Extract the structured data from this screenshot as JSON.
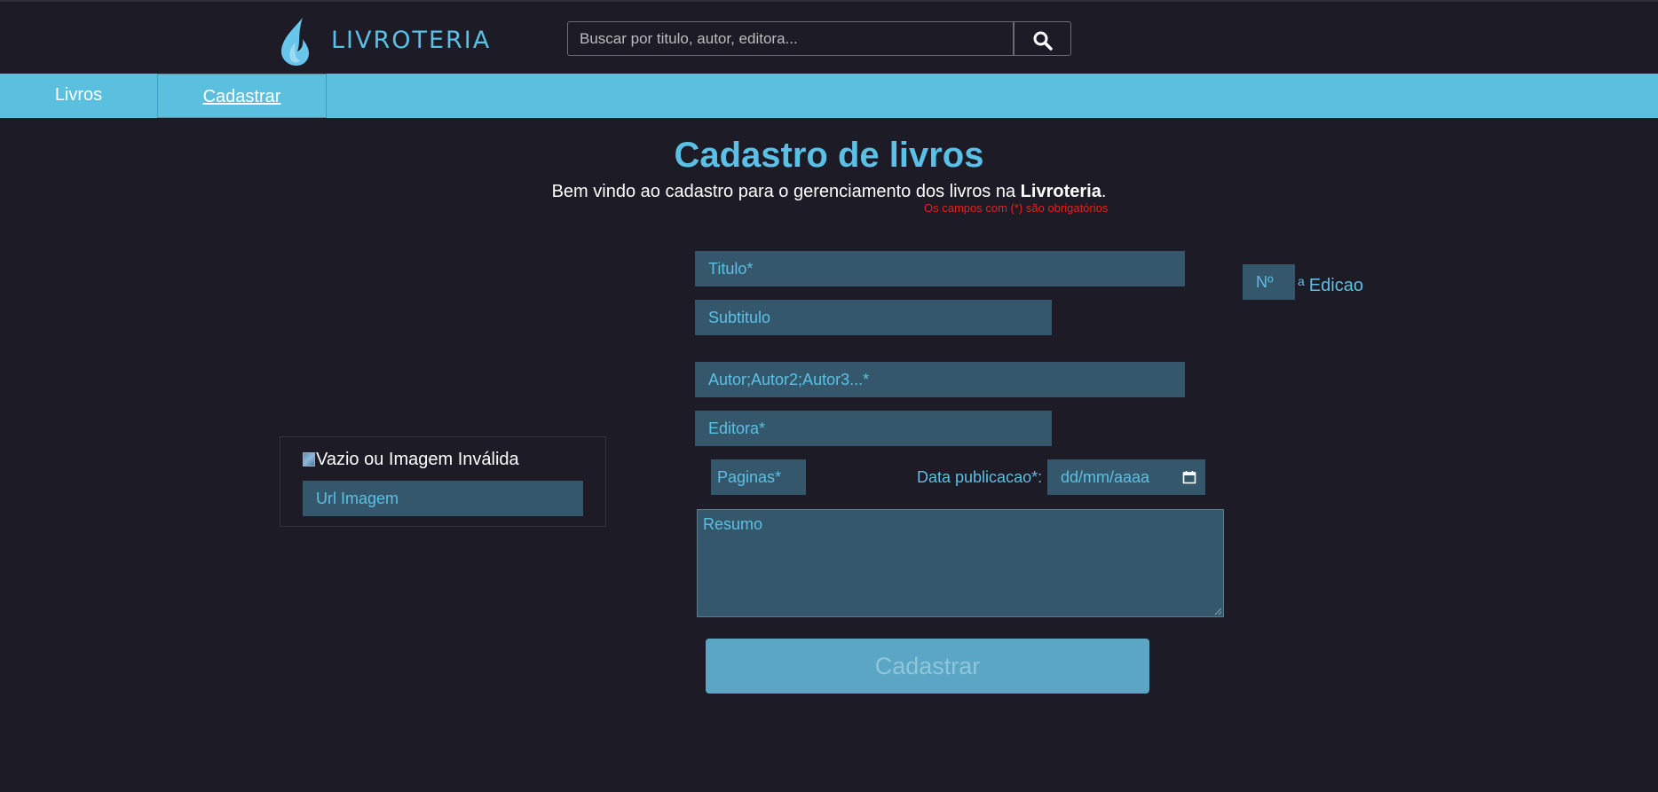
{
  "header": {
    "brand": "LIVROTERIA",
    "search_placeholder": "Buscar por titulo, autor, editora..."
  },
  "nav": {
    "items": [
      {
        "label": "Livros"
      },
      {
        "label": "Cadastrar"
      }
    ]
  },
  "main": {
    "title": "Cadastro de livros",
    "welcome_prefix": "Bem vindo ao cadastro para o gerenciamento dos livros na ",
    "welcome_brand": "Livroteria",
    "welcome_suffix": ".",
    "required_note": "Os campos com (*) são obrigatórios"
  },
  "image_card": {
    "alt_text": "Vazio ou Imagem Inválida",
    "url_placeholder": "Url Imagem"
  },
  "form": {
    "titulo_placeholder": "Titulo*",
    "subtitulo_placeholder": "Subtitulo",
    "edicao_placeholder": "Nº",
    "edicao_sup": "a",
    "edicao_label": "Edicao",
    "autor_placeholder": "Autor;Autor2;Autor3...*",
    "editora_placeholder": "Editora*",
    "paginas_placeholder": "Paginas*",
    "data_label": "Data publicacao*:",
    "data_placeholder": "dd/mm/aaaa",
    "resumo_placeholder": "Resumo",
    "submit_label": "Cadastrar"
  },
  "colors": {
    "background": "#1c1b26",
    "accent": "#5bc0e6",
    "navbar": "#5bc0e0",
    "field_bg": "#34576b",
    "submit_bg": "#5aa6c4",
    "required": "#e8201c"
  },
  "icons": [
    "flame-logo-icon",
    "search-icon",
    "calendar-icon",
    "broken-image-icon"
  ]
}
